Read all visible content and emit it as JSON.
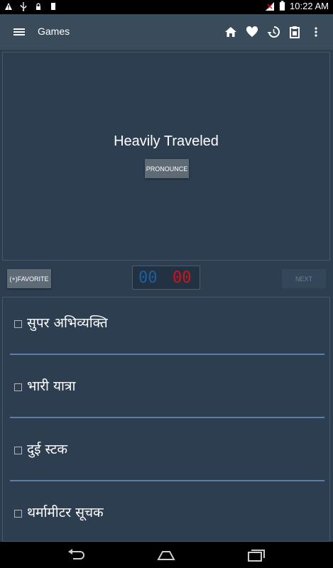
{
  "status_bar": {
    "time": "10:22",
    "time_suffix": "AM",
    "left_icons": [
      "warning-icon",
      "usb-icon",
      "lock-icon",
      "sd-card-icon"
    ],
    "right_icons": [
      "signal-icon",
      "battery-icon"
    ]
  },
  "app_bar": {
    "title": "Games",
    "actions": [
      "home-icon",
      "heart-icon",
      "history-icon",
      "clipboard-icon",
      "more-vert-icon"
    ]
  },
  "card": {
    "word": "Heavily Traveled",
    "pronounce_label": "PRONOUNCE"
  },
  "controls": {
    "favorite_label": "(+)FAVORITE",
    "score_correct": "00",
    "score_wrong": "00",
    "next_label": "NEXT"
  },
  "options": [
    {
      "label": "सुपर अभिव्यक्ति"
    },
    {
      "label": "भारी यात्रा"
    },
    {
      "label": "दुई स्टक"
    },
    {
      "label": "थर्मामीटर सूचक"
    }
  ],
  "nav": [
    "back-icon",
    "home-nav-icon",
    "recents-icon"
  ],
  "colors": {
    "background": "#2c3e50",
    "app_bar": "#3a4c5c",
    "divider": "#5d7ea8",
    "score_correct": "#1b5f9e",
    "score_wrong": "#d0121b"
  }
}
